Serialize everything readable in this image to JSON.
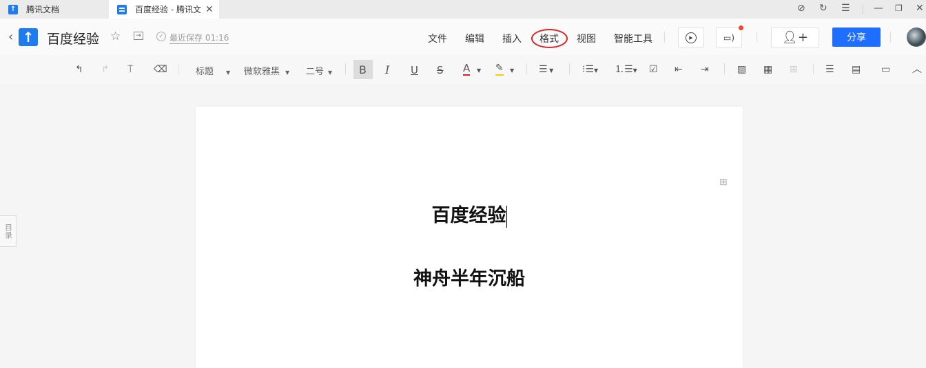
{
  "tabs": [
    {
      "label": "腾讯文档"
    },
    {
      "label": "百度经验 - 腾讯文"
    }
  ],
  "header": {
    "title": "百度经验",
    "save_status": "最近保存 01:16",
    "menu": [
      "文件",
      "编辑",
      "插入",
      "格式",
      "视图",
      "智能工具"
    ],
    "share_label": "分享"
  },
  "toolbar": {
    "style": "标题",
    "font": "微软雅黑",
    "size": "二号"
  },
  "sidebar": {
    "toc": "目录"
  },
  "document": {
    "title": "百度经验",
    "subtitle": "神舟半年沉船"
  },
  "colors": {
    "accent": "#1e6fff",
    "highlight_circle": "#e02020"
  }
}
